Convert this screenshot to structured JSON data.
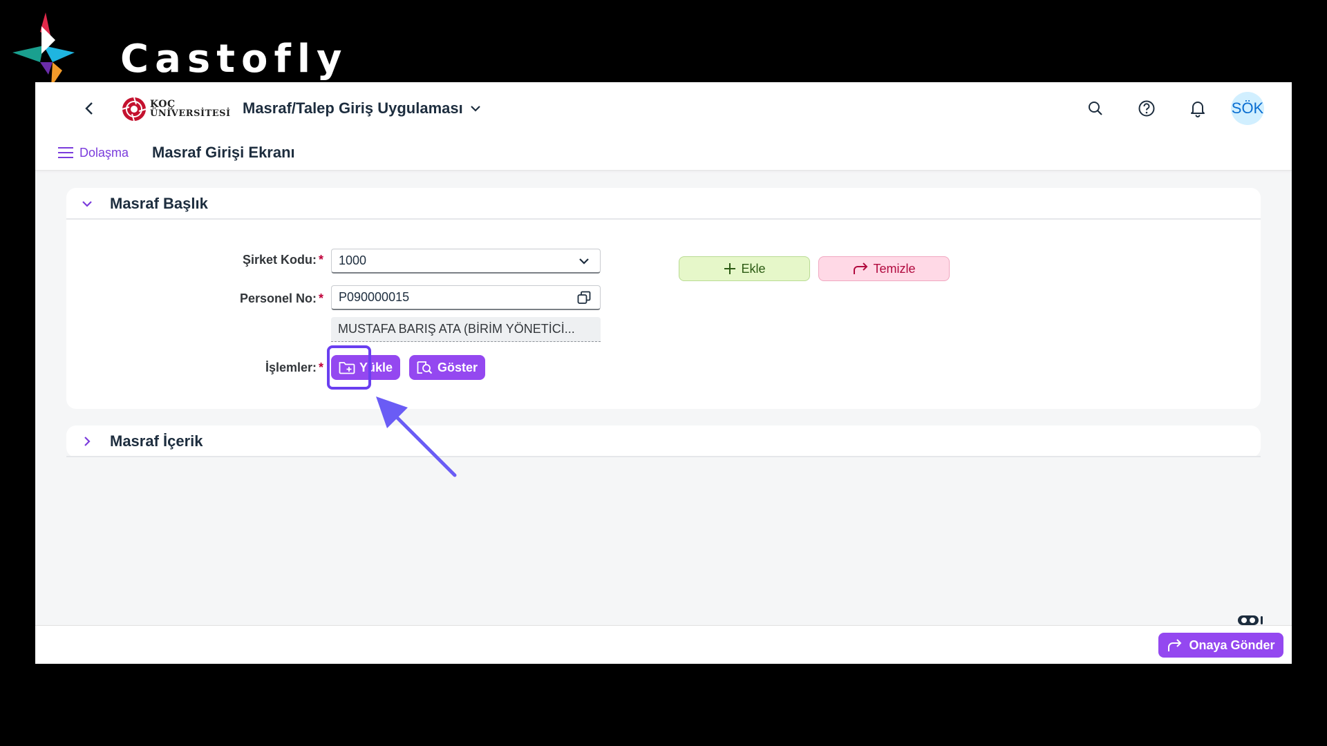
{
  "brand": {
    "name": "Castofly"
  },
  "shellbar": {
    "university_line1": "KOÇ",
    "university_line2": "ÜNİVERSİTESİ",
    "app_title": "Masraf/Talep Giriş Uygulaması",
    "avatar_initials": "SÖK"
  },
  "subheader": {
    "nav_label": "Dolaşma",
    "page_title": "Masraf Girişi Ekranı"
  },
  "header_panel": {
    "title": "Masraf Başlık",
    "company_code_label": "Şirket Kodu:",
    "company_code_value": "1000",
    "personnel_no_label": "Personel No:",
    "personnel_no_value": "P090000015",
    "personnel_name": "MUSTAFA BARIŞ  ATA (BİRİM YÖNETİCİ...",
    "operations_label": "İşlemler:",
    "required_mark": "*",
    "upload_label": "Yükle",
    "show_label": "Göster",
    "add_label": "Ekle",
    "clear_label": "Temizle"
  },
  "content_panel": {
    "title": "Masraf İçerik"
  },
  "footer": {
    "submit_label": "Onaya Gönder"
  },
  "colors": {
    "accent_purple": "#9448f0",
    "highlight": "#6a3ff0",
    "link_purple": "#7a3bdc"
  }
}
